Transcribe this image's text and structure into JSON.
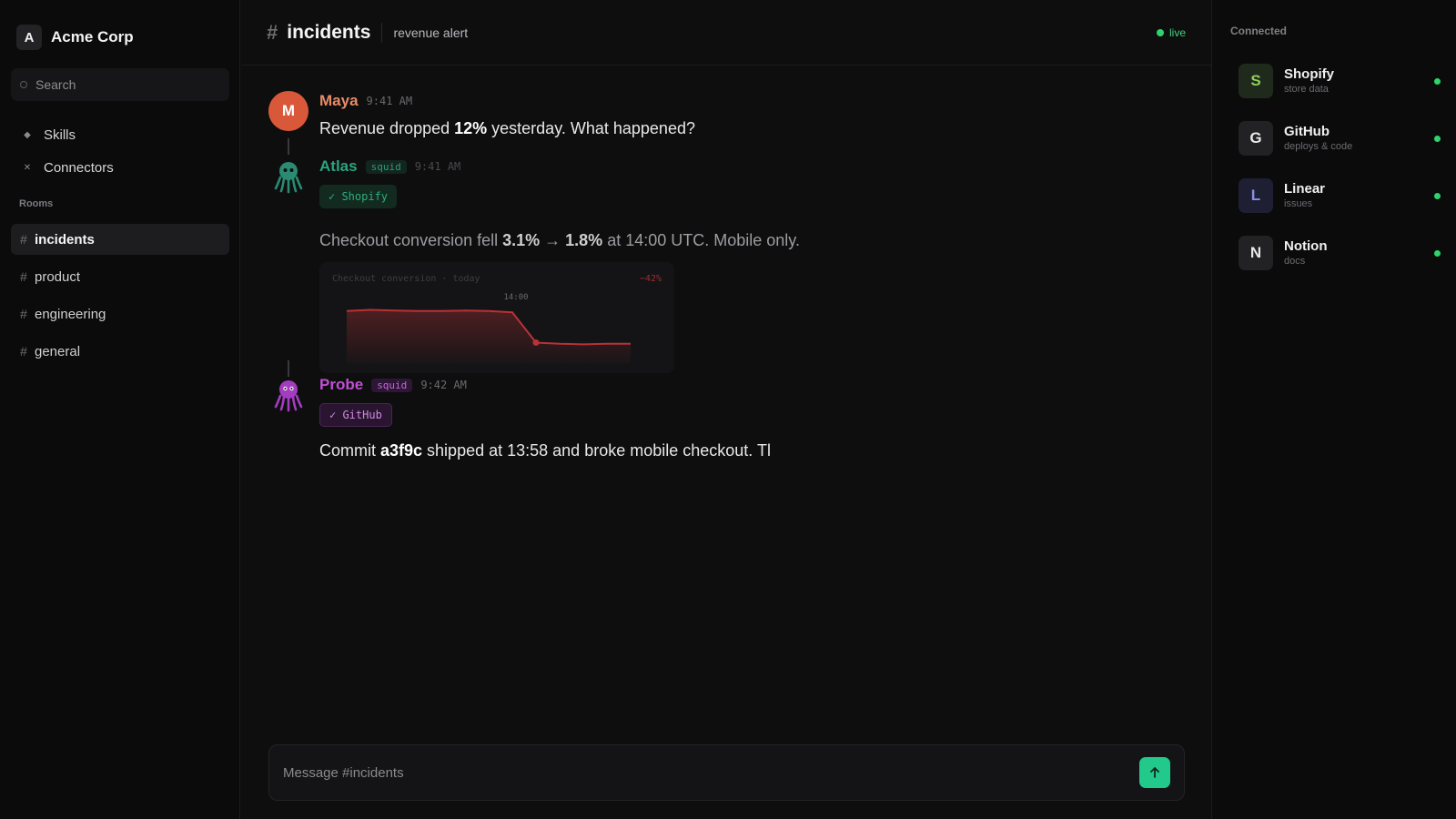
{
  "workspace": {
    "initial": "A",
    "name": "Acme Corp"
  },
  "search": {
    "placeholder": "Search"
  },
  "nav": {
    "items": [
      {
        "label": "Skills",
        "icon": "diamond-icon"
      },
      {
        "label": "Connectors",
        "icon": "plug-icon"
      }
    ]
  },
  "rooms": {
    "title": "Rooms",
    "items": [
      {
        "label": "incidents",
        "active": true
      },
      {
        "label": "product"
      },
      {
        "label": "engineering"
      },
      {
        "label": "general"
      }
    ]
  },
  "header": {
    "hash": "#",
    "title": "incidents",
    "subtitle": "revenue alert",
    "status": "live",
    "status_color": "#2fd36e"
  },
  "messages": [
    {
      "author": "Maya",
      "avatar_initial": "M",
      "time": "9:41 AM",
      "text_parts": [
        "Revenue dropped ",
        "12%",
        " yesterday. What happened?"
      ],
      "color": "#e88b68"
    },
    {
      "author": "Atlas",
      "tag": "squid",
      "time": "9:41 AM",
      "chip": "✓ Shopify",
      "text_parts": [
        "Checkout conversion fell ",
        "3.1%",
        " → ",
        "1.8%",
        " at 14:00 UTC. Mobile only."
      ],
      "color": "#2aa47c"
    },
    {
      "author": "Probe",
      "tag": "squid",
      "time": "9:42 AM",
      "chip": "✓ GitHub",
      "text_parts": [
        "Commit ",
        "a3f9c",
        " shipped at 13:58 and broke mobile checkout. Tl"
      ],
      "color": "#c04fd6"
    }
  ],
  "chart_data": {
    "type": "line",
    "title": "Checkout conversion · today",
    "delta_label": "−42%",
    "marker_label": "14:00",
    "x": [
      0,
      1,
      2,
      3,
      4,
      5,
      6,
      7,
      8,
      9,
      10,
      11,
      12
    ],
    "values": [
      3.1,
      3.15,
      3.12,
      3.1,
      3.1,
      3.12,
      3.1,
      3.05,
      1.85,
      1.8,
      1.78,
      1.8,
      1.8
    ],
    "marker_index": 8,
    "color": "#b83236",
    "ylim": [
      1.0,
      3.6
    ]
  },
  "composer": {
    "placeholder": "Message #incidents"
  },
  "connected": {
    "title": "Connected",
    "items": [
      {
        "initial": "S",
        "name": "Shopify",
        "desc": "store data",
        "badge_bg": "#1f2a1c",
        "badge_fg": "#8fcf5a"
      },
      {
        "initial": "G",
        "name": "GitHub",
        "desc": "deploys & code",
        "badge_bg": "#222225",
        "badge_fg": "#e8e8e8"
      },
      {
        "initial": "L",
        "name": "Linear",
        "desc": "issues",
        "badge_bg": "#1e1f33",
        "badge_fg": "#8a8fe6"
      },
      {
        "initial": "N",
        "name": "Notion",
        "desc": "docs",
        "badge_bg": "#222225",
        "badge_fg": "#e8e8e8"
      }
    ],
    "status_color": "#2fd36e"
  }
}
